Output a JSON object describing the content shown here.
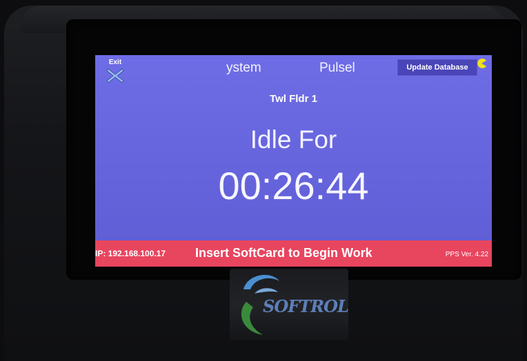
{
  "screen": {
    "exit_label": "Exit",
    "header_left": "ystem",
    "header_right": "Pulsel",
    "update_button": "Update Database",
    "station_name": "Twl Fldr 1",
    "idle_label": "Idle For",
    "idle_timer": "00:26:44",
    "ip_address": "IP: 192.168.100.17",
    "instruction": "Insert SoftCard to Begin Work",
    "version": "PPS Ver. 4.22"
  },
  "device": {
    "logo_text": "SOFTROL"
  },
  "colors": {
    "screen_background": "#6664dc",
    "status_bar": "#e8455f",
    "update_button": "#4a45b8",
    "logo_blue": "#4a8fd0",
    "logo_green": "#3a8a3c"
  },
  "icons": {
    "exit": "close-x-icon",
    "sync": "pacman-sync-icon"
  }
}
